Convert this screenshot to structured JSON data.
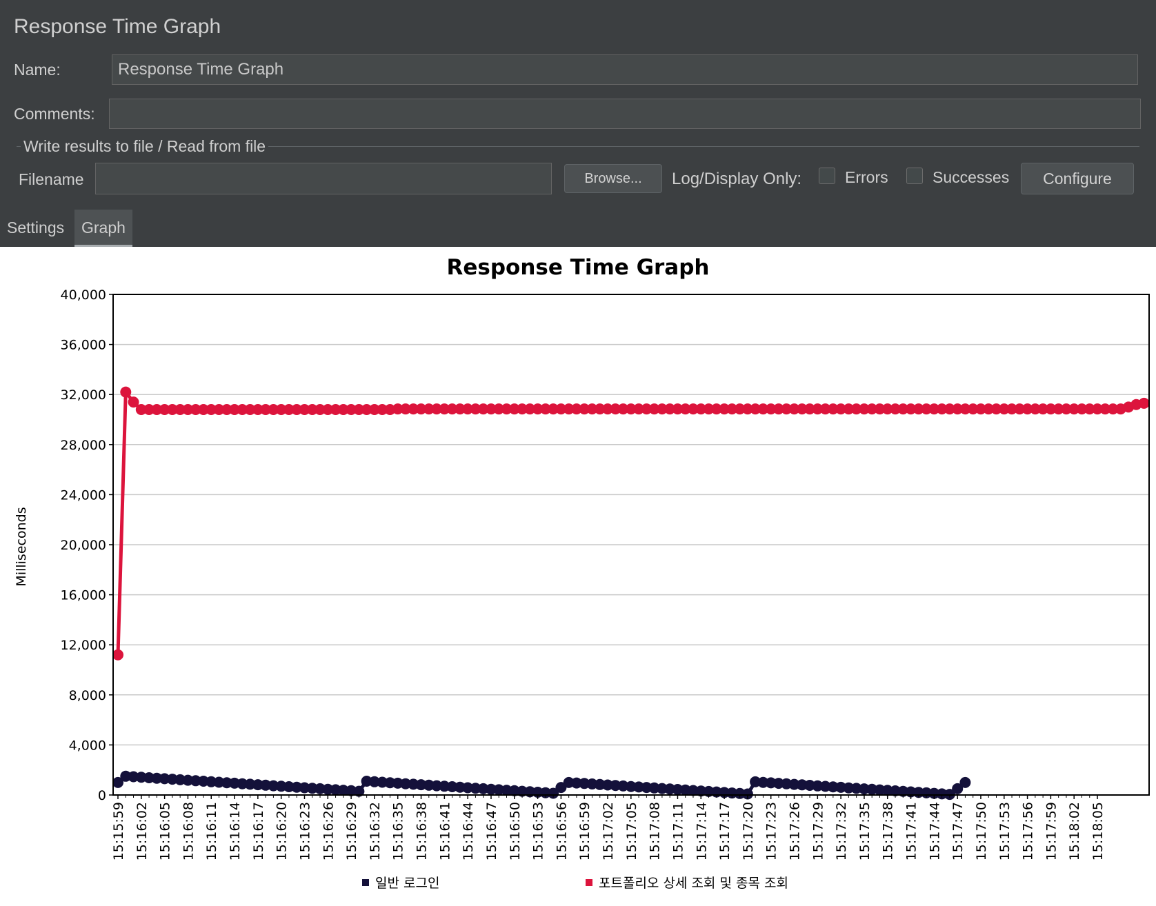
{
  "panel": {
    "title": "Response Time Graph",
    "name_label": "Name:",
    "name_value": "Response Time Graph",
    "comments_label": "Comments:",
    "comments_value": "",
    "file_section_label": "Write results to file / Read from file",
    "filename_label": "Filename",
    "filename_value": "",
    "browse_label": "Browse...",
    "log_display_label": "Log/Display Only:",
    "errors_label": "Errors",
    "errors_checked": false,
    "successes_label": "Successes",
    "successes_checked": false,
    "configure_label": "Configure"
  },
  "tabs": [
    {
      "label": "Settings",
      "active": false
    },
    {
      "label": "Graph",
      "active": true
    }
  ],
  "colors": {
    "panel_bg": "#3c3f41",
    "series_login": "#14113a",
    "series_portfolio": "#dc143c"
  },
  "chart_data": {
    "type": "line",
    "title": "Response Time Graph",
    "ylabel": "Milliseconds",
    "xlabel": "",
    "ylim": [
      0,
      40000
    ],
    "yticks": [
      "0",
      "4,000",
      "8,000",
      "12,000",
      "16,000",
      "20,000",
      "24,000",
      "28,000",
      "32,000",
      "36,000",
      "40,000"
    ],
    "grid": true,
    "legend_position": "bottom",
    "x_tick_labels": [
      "15:15:59",
      "15:16:02",
      "15:16:05",
      "15:16:08",
      "15:16:11",
      "15:16:14",
      "15:16:17",
      "15:16:20",
      "15:16:23",
      "15:16:26",
      "15:16:29",
      "15:16:32",
      "15:16:35",
      "15:16:38",
      "15:16:41",
      "15:16:44",
      "15:16:47",
      "15:16:50",
      "15:16:53",
      "15:16:56",
      "15:16:59",
      "15:17:02",
      "15:17:05",
      "15:17:08",
      "15:17:11",
      "15:17:14",
      "15:17:17",
      "15:17:20",
      "15:17:23",
      "15:17:26",
      "15:17:29",
      "15:17:32",
      "15:17:35",
      "15:17:38",
      "15:17:41",
      "15:17:44",
      "15:17:47",
      "15:17:50",
      "15:17:53",
      "15:17:56",
      "15:17:59",
      "15:18:02",
      "15:18:05"
    ],
    "x_start": "15:15:59",
    "x_step_seconds": 1,
    "series": [
      {
        "name": "일반 로그인",
        "color": "#14113a",
        "values": [
          1000,
          1500,
          1460,
          1420,
          1380,
          1340,
          1300,
          1260,
          1220,
          1180,
          1140,
          1100,
          1060,
          1020,
          980,
          940,
          900,
          860,
          820,
          780,
          740,
          700,
          660,
          620,
          580,
          540,
          500,
          460,
          420,
          380,
          340,
          300,
          1100,
          1060,
          1020,
          980,
          940,
          900,
          860,
          820,
          780,
          740,
          700,
          660,
          620,
          580,
          540,
          500,
          460,
          420,
          380,
          340,
          300,
          260,
          220,
          180,
          140,
          600,
          1000,
          960,
          920,
          880,
          840,
          800,
          760,
          720,
          680,
          640,
          600,
          560,
          520,
          480,
          440,
          400,
          360,
          320,
          280,
          240,
          200,
          160,
          120,
          80,
          1050,
          1010,
          970,
          930,
          890,
          850,
          810,
          770,
          730,
          690,
          650,
          610,
          570,
          530,
          490,
          450,
          410,
          370,
          330,
          290,
          250,
          210,
          170,
          130,
          90,
          50,
          500,
          1000
        ]
      },
      {
        "name": "포트폴리오 상세 조회 및 종목 조회",
        "color": "#dc143c",
        "values": [
          11200,
          32200,
          31400,
          30800,
          30800,
          30800,
          30800,
          30800,
          30800,
          30800,
          30800,
          30800,
          30800,
          30800,
          30800,
          30800,
          30800,
          30800,
          30800,
          30800,
          30800,
          30800,
          30800,
          30800,
          30800,
          30800,
          30800,
          30800,
          30800,
          30800,
          30800,
          30800,
          30800,
          30800,
          30800,
          30800,
          30850,
          30850,
          30850,
          30850,
          30850,
          30850,
          30850,
          30850,
          30850,
          30850,
          30850,
          30850,
          30850,
          30850,
          30850,
          30850,
          30850,
          30850,
          30850,
          30850,
          30850,
          30850,
          30850,
          30850,
          30850,
          30850,
          30850,
          30850,
          30850,
          30850,
          30850,
          30850,
          30850,
          30850,
          30850,
          30850,
          30850,
          30850,
          30850,
          30850,
          30850,
          30850,
          30850,
          30850,
          30850,
          30850,
          30850,
          30850,
          30850,
          30850,
          30850,
          30850,
          30850,
          30850,
          30850,
          30850,
          30850,
          30850,
          30850,
          30850,
          30850,
          30850,
          30850,
          30850,
          30850,
          30850,
          30850,
          30850,
          30850,
          30850,
          30850,
          30850,
          30850,
          30850,
          30850,
          30850,
          30850,
          30850,
          30850,
          30850,
          30850,
          30850,
          30850,
          30850,
          30850,
          30850,
          30850,
          30850,
          30850,
          30850,
          30850,
          30850,
          30850,
          30850,
          31000,
          31200,
          31300
        ]
      }
    ]
  }
}
